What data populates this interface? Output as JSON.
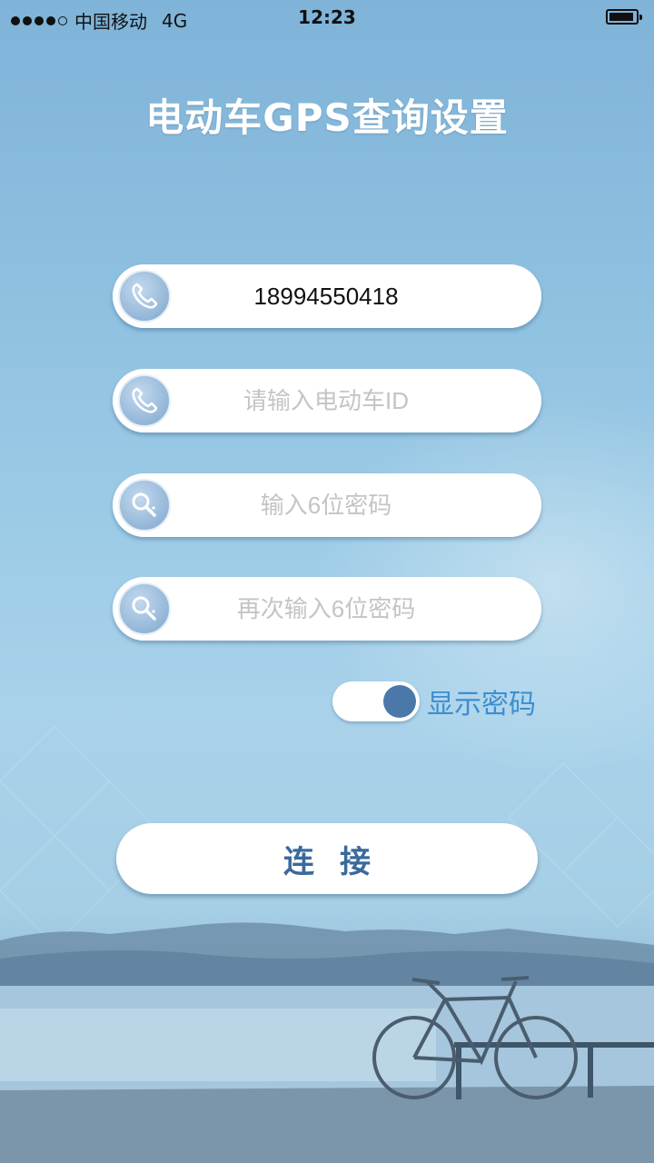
{
  "status_bar": {
    "carrier": "中国移动",
    "network": "4G",
    "time": "12:23"
  },
  "page_title": "电动车GPS查询设置",
  "fields": {
    "phone": {
      "value": "18994550418",
      "placeholder": "",
      "icon": "phone-icon"
    },
    "vehicle_id": {
      "value": "",
      "placeholder": "请输入电动车ID",
      "icon": "phone-icon"
    },
    "password": {
      "value": "",
      "placeholder": "输入6位密码",
      "icon": "key-icon"
    },
    "password_confirm": {
      "value": "",
      "placeholder": "再次输入6位密码",
      "icon": "key-icon"
    }
  },
  "show_password": {
    "label": "显示密码",
    "on": true
  },
  "connect_button": {
    "label": "连接"
  },
  "colors": {
    "accent": "#4a78a8",
    "label_blue": "#3c8ed0",
    "button_text": "#3a6a9c",
    "placeholder": "#c4c4c8"
  }
}
